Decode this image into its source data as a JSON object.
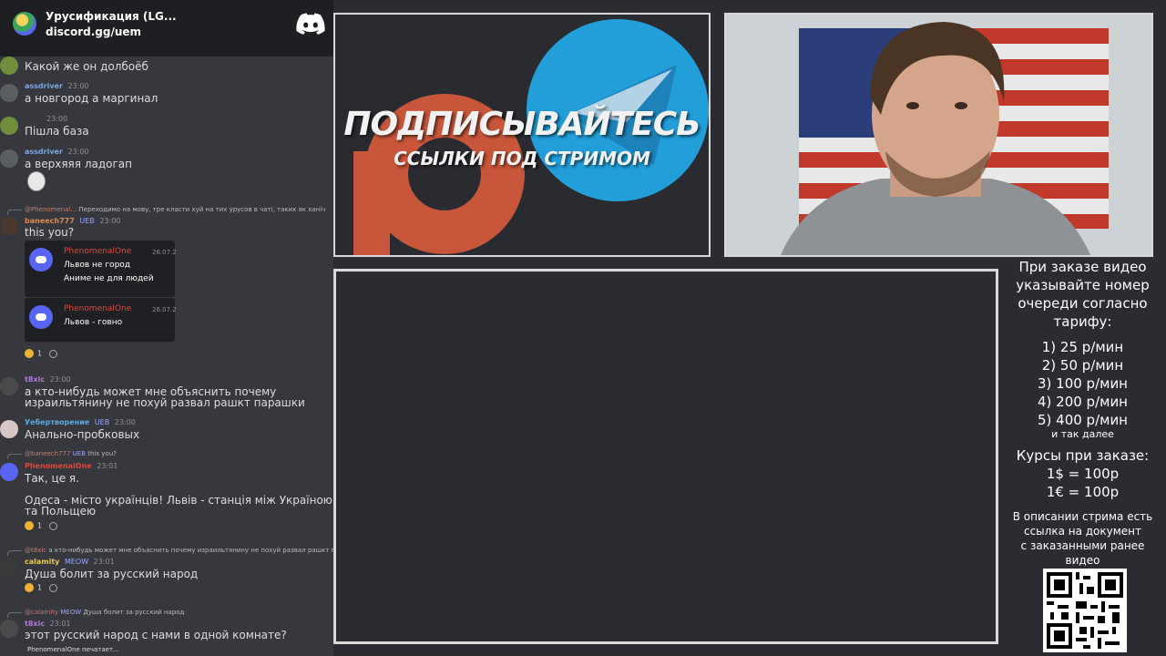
{
  "chat": {
    "server_name": "Урусификация (LG...",
    "server_invite": "discord.gg/uem",
    "messages": [
      {
        "text": "Какой же он долбоёб"
      },
      {
        "user": "assdriver",
        "time": "23:00",
        "text": "а новгород а маргинал"
      },
      {
        "user": "",
        "time": "23:00",
        "text": "Пішла база"
      },
      {
        "user": "assdriver",
        "time": "23:00",
        "text": "а верхяяя ладогап"
      },
      {
        "reply_user": "@Phenomenal...",
        "reply_text": "Переходимо на мову, тре класти хуй на тих урусов в чаті, таких як ханїч",
        "user": "baneech777",
        "badge": "UEB",
        "time": "23:00",
        "text": "this you?"
      },
      {
        "user": "t8xic",
        "time": "23:00",
        "text": "а кто-нибудь может мне объяснить почему",
        "text2": "израильтянину не похуй развал рашкт парашки"
      },
      {
        "user": "Уебертворение",
        "badge": "UEB",
        "time": "23:00",
        "text": "Анально-пробковых"
      },
      {
        "reply_user": "@baneech777",
        "reply_badge": "UEB",
        "reply_text": "this you?",
        "user": "PhenomenalOne",
        "time": "23:01",
        "text": "Так, це я.",
        "text2": "Одеса - місто українців! Львів - станція між Україною",
        "text3": "та Польщею"
      },
      {
        "reply_user": "@t8xic",
        "reply_text": "а кто-нибудь может мне объяснить почему израильтянину не похуй развал рашкт парашки",
        "user": "calamity",
        "badge": "MEOW",
        "time": "23:01",
        "text": "Душа болит за русский народ"
      },
      {
        "reply_user": "@calamity",
        "reply_badge": "MEOW",
        "reply_text": "Душа болит за русский народ",
        "user": "t8xic",
        "time": "23:01",
        "text": "этот русский народ с нами в одной комнате?"
      }
    ],
    "embed": [
      {
        "user": "PhenomenalOne",
        "date": "26.07.2",
        "lines": [
          "Львов не город",
          "Аниме не для людей"
        ]
      },
      {
        "user": "PhenomenalOne",
        "date": "26.07.2",
        "lines": [
          "Львов - говно"
        ]
      }
    ],
    "reactions": [
      "1",
      "1",
      "1"
    ],
    "typing": "PhenomenalOne печатает..."
  },
  "promo": {
    "title": "ПОДПИСЫВАЙТЕСЬ",
    "subtitle": "ССЫЛКИ ПОД СТРИМОМ"
  },
  "info": {
    "order_note": [
      "При заказе видео",
      "указывайте номер",
      "очереди согласно",
      "тарифу:"
    ],
    "tariffs": [
      "1) 25 р/мин",
      "2) 50 р/мин",
      "3) 100 р/мин",
      "4) 200 р/мин",
      "5) 400 р/мин"
    ],
    "etc": "и так далее",
    "rates_title": "Курсы при заказе:",
    "rates": [
      "1$ = 100р",
      "1€ = 100р"
    ],
    "doc_note": [
      "В описании стрима есть",
      "ссылка на документ",
      "с заказанными ранее",
      "видео"
    ]
  },
  "colors": {
    "discord_bg": "#36383e",
    "header_bg": "#1e1f22",
    "blurple": "#5865f2",
    "patreon": "#f96854",
    "telegram": "#229ed9"
  }
}
